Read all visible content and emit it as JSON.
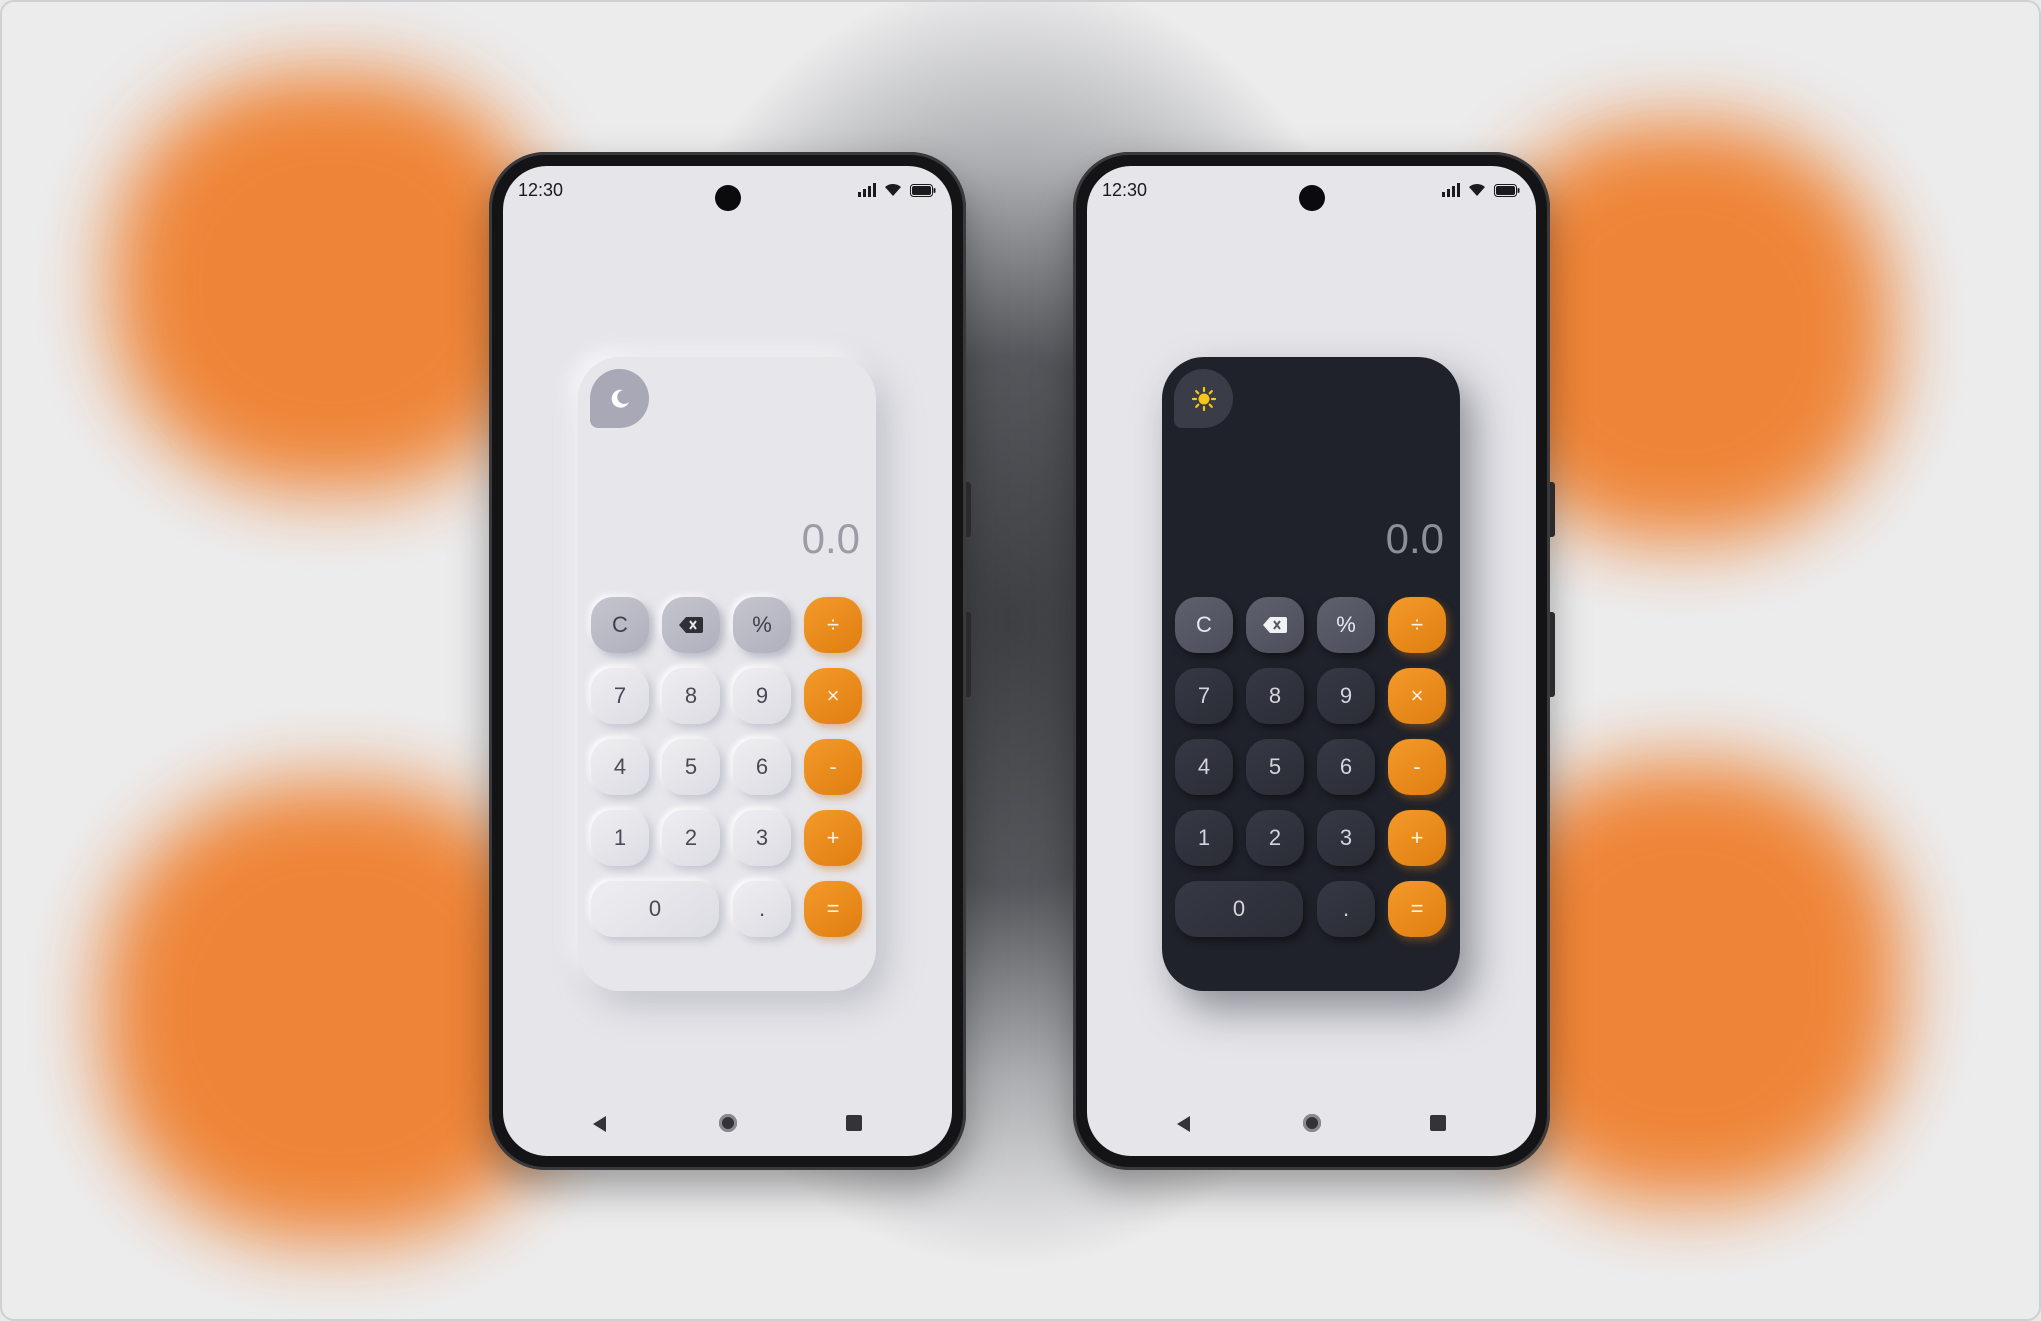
{
  "colors": {
    "accent": "#ef8a1f",
    "blob": "#ef7d2a",
    "light_panel": "#e6e6eb",
    "dark_panel": "#1f222a"
  },
  "phones": [
    {
      "theme": "light",
      "status": {
        "time": "12:30"
      },
      "mode_toggle_icon": "moon-icon",
      "display": "0.0",
      "keys": {
        "clear": "C",
        "backspace_icon": "backspace-icon",
        "percent": "%",
        "divide": "÷",
        "seven": "7",
        "eight": "8",
        "nine": "9",
        "multiply": "×",
        "four": "4",
        "five": "5",
        "six": "6",
        "minus": "-",
        "one": "1",
        "two": "2",
        "three": "3",
        "plus": "+",
        "zero": "0",
        "decimal": ".",
        "equals": "="
      }
    },
    {
      "theme": "dark",
      "status": {
        "time": "12:30"
      },
      "mode_toggle_icon": "sun-icon",
      "display": "0.0",
      "keys": {
        "clear": "C",
        "backspace_icon": "backspace-icon",
        "percent": "%",
        "divide": "÷",
        "seven": "7",
        "eight": "8",
        "nine": "9",
        "multiply": "×",
        "four": "4",
        "five": "5",
        "six": "6",
        "minus": "-",
        "one": "1",
        "two": "2",
        "three": "3",
        "plus": "+",
        "zero": "0",
        "decimal": ".",
        "equals": "="
      }
    }
  ]
}
